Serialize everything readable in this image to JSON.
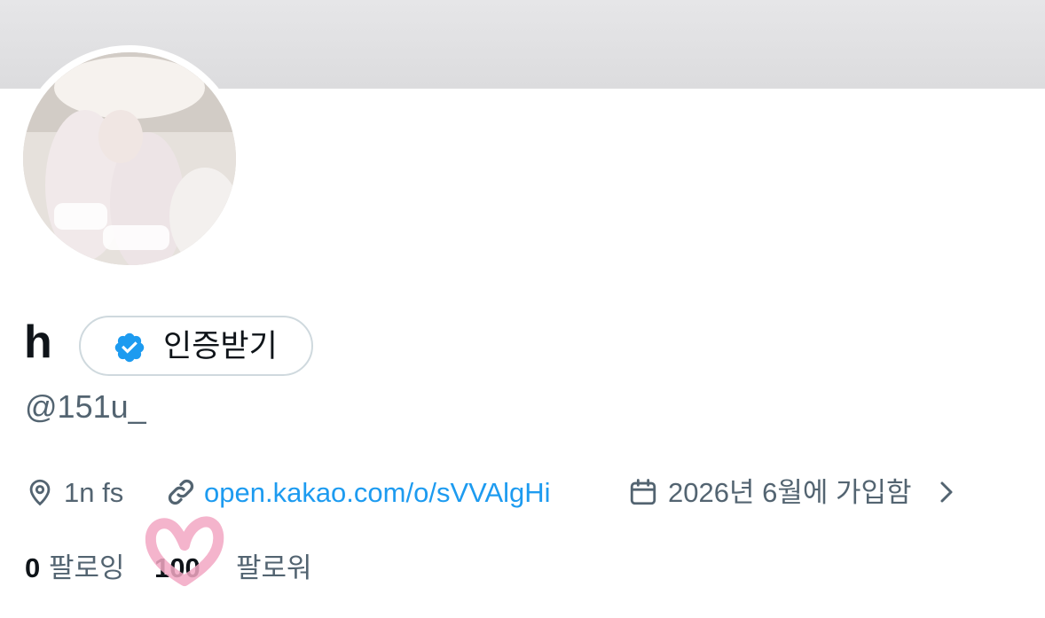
{
  "profile": {
    "display_name": "h",
    "handle": "@151u_",
    "verify_button_label": "인증받기",
    "location": "1n fs",
    "website": "open.kakao.com/o/sVVAlgHi",
    "joined": "2026년 6월에 가입함",
    "following_count": "0",
    "following_label": "팔로잉",
    "followers_count": "100",
    "followers_label": "팔로워"
  },
  "icons": {
    "location": "location-pin-icon",
    "link": "link-icon",
    "calendar": "calendar-icon",
    "chevron": "chevron-right-icon",
    "verified": "verified-badge-icon"
  },
  "colors": {
    "link": "#1d9bf0",
    "secondary_text": "#536471",
    "primary_text": "#0f1419",
    "verified_badge": "#1d9bf0",
    "doodle_heart": "#f2a7c3"
  }
}
